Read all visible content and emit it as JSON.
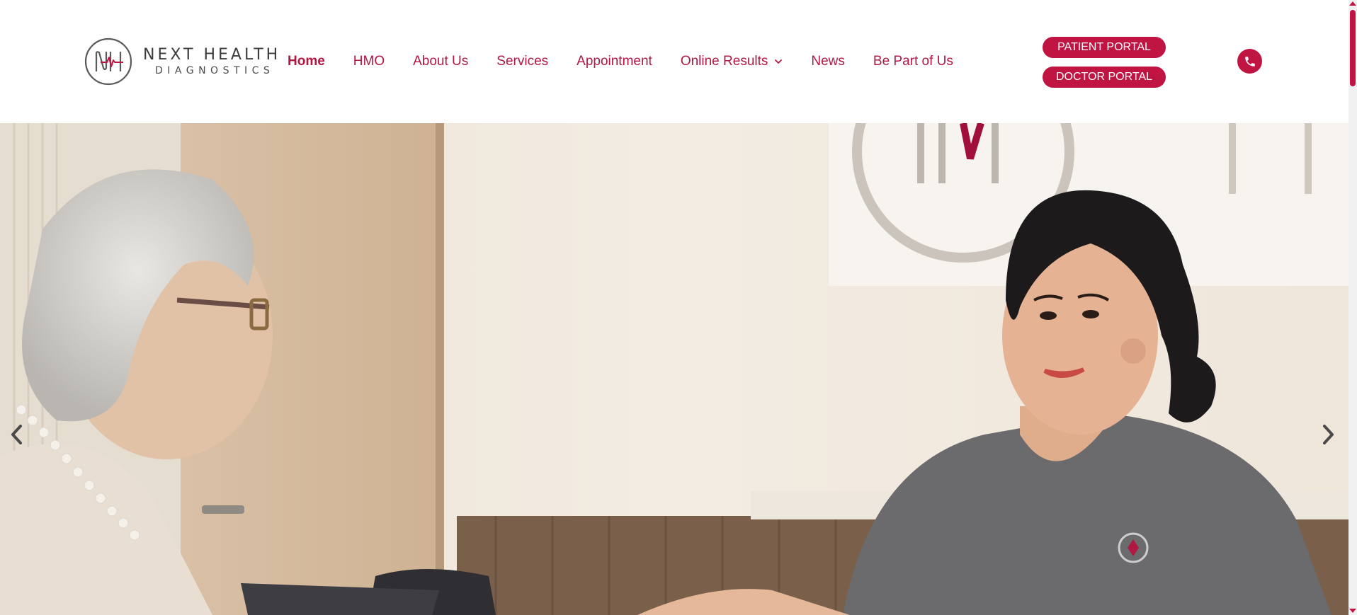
{
  "brand": {
    "name_line1": "NEXT HEALTH",
    "name_line2": "DIAGNOSTICS",
    "accent_color": "#c01442",
    "link_color": "#b01842"
  },
  "nav": {
    "items": [
      {
        "label": "Home",
        "active": true
      },
      {
        "label": "HMO"
      },
      {
        "label": "About Us"
      },
      {
        "label": "Services"
      },
      {
        "label": "Appointment"
      },
      {
        "label": "Online Results",
        "has_dropdown": true
      },
      {
        "label": "News"
      },
      {
        "label": "Be Part of Us"
      }
    ]
  },
  "portals": {
    "patient_label": "PATIENT PORTAL",
    "doctor_label": "DOCTOR PORTAL"
  },
  "icons": {
    "phone": "phone-icon",
    "prev": "chevron-left-icon",
    "next": "chevron-right-icon",
    "dropdown": "chevron-down-icon"
  }
}
